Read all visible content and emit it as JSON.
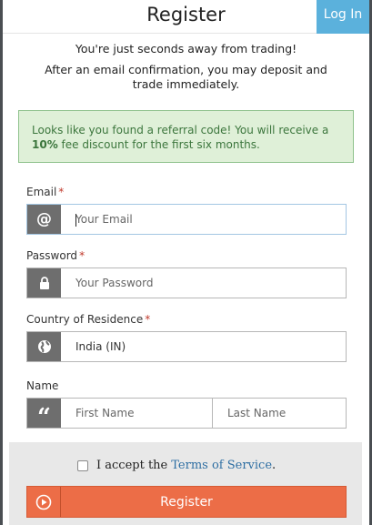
{
  "header": {
    "title": "Register",
    "login_label": "Log In"
  },
  "intro": {
    "line1": "You're just seconds away from trading!",
    "line2": "After an email confirmation, you may deposit and trade immediately."
  },
  "referral_alert": {
    "text_before": "Looks like you found a referral code! You will receive a ",
    "highlight": "10%",
    "text_after": " fee discount for the first six months."
  },
  "form": {
    "email": {
      "label": "Email",
      "required_mark": "*",
      "placeholder": "Your Email",
      "icon": "at-icon"
    },
    "password": {
      "label": "Password",
      "required_mark": "*",
      "placeholder": "Your Password",
      "icon": "lock-icon"
    },
    "country": {
      "label": "Country of Residence",
      "required_mark": "*",
      "value": "India (IN)",
      "icon": "globe-icon"
    },
    "name": {
      "label": "Name",
      "first_placeholder": "First Name",
      "last_placeholder": "Last Name",
      "icon": "quote-icon"
    }
  },
  "footer": {
    "accept_text": "I accept the",
    "terms_link": "Terms of Service",
    "terms_suffix": ".",
    "register_label": "Register",
    "register_icon": "play-circle-icon"
  },
  "colors": {
    "accent_blue": "#5bb1dc",
    "register_orange": "#ec6d47",
    "alert_green_bg": "#dff0d8",
    "alert_green_text": "#3c763d",
    "addon_gray": "#6e6e6e"
  }
}
